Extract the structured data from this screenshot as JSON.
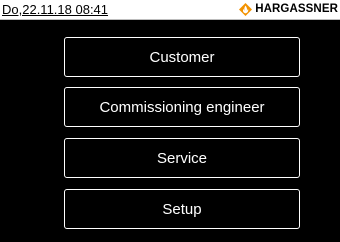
{
  "status_bar": {
    "datetime": "Do,22.11.18 08:41",
    "brand_name": "HARGASSNER",
    "brand_logo_icon": "diamond-flame-logo",
    "brand_logo_color": "#F39200"
  },
  "menu": {
    "customer": "Customer",
    "commissioning_engineer": "Commissioning engineer",
    "service": "Service",
    "setup": "Setup"
  },
  "colors": {
    "background": "#000000",
    "status_bar": "#FFFFFF",
    "button_border": "#FFFFFF",
    "button_text": "#FFFFFF"
  }
}
